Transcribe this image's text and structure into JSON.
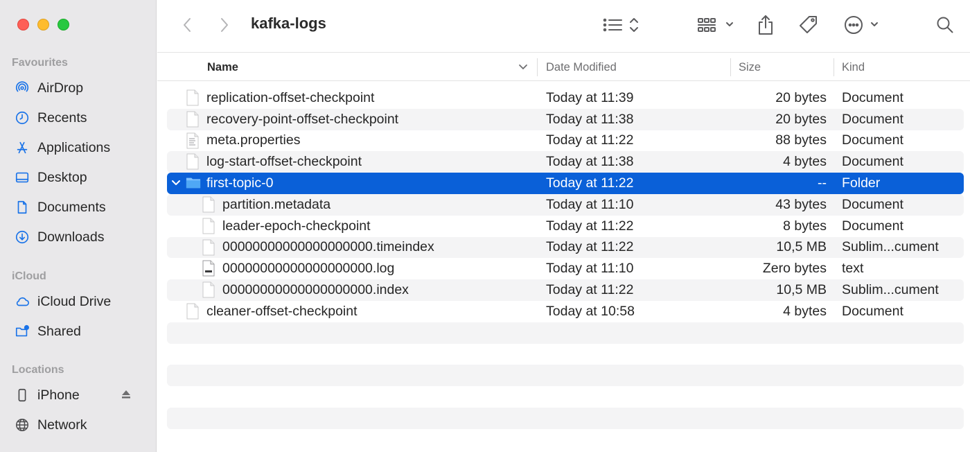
{
  "window": {
    "title": "kafka-logs"
  },
  "sidebar": {
    "sections": [
      {
        "title": "Favourites"
      },
      {
        "title": "iCloud"
      },
      {
        "title": "Locations"
      }
    ],
    "favourites": [
      {
        "label": "AirDrop",
        "icon": "airdrop-icon"
      },
      {
        "label": "Recents",
        "icon": "clock-icon"
      },
      {
        "label": "Applications",
        "icon": "applications-icon"
      },
      {
        "label": "Desktop",
        "icon": "desktop-icon"
      },
      {
        "label": "Documents",
        "icon": "document-icon"
      },
      {
        "label": "Downloads",
        "icon": "download-icon"
      }
    ],
    "icloud": [
      {
        "label": "iCloud Drive",
        "icon": "cloud-icon"
      },
      {
        "label": "Shared",
        "icon": "shared-folder-icon"
      }
    ],
    "locations": [
      {
        "label": "iPhone",
        "icon": "iphone-icon"
      },
      {
        "label": "Network",
        "icon": "globe-icon"
      }
    ]
  },
  "columns": {
    "name": "Name",
    "date": "Date Modified",
    "size": "Size",
    "kind": "Kind"
  },
  "files": [
    {
      "name": "replication-offset-checkpoint",
      "date": "Today at 11:39",
      "size": "20 bytes",
      "kind": "Document",
      "icon": "document-icon"
    },
    {
      "name": "recovery-point-offset-checkpoint",
      "date": "Today at 11:38",
      "size": "20 bytes",
      "kind": "Document",
      "icon": "document-icon"
    },
    {
      "name": "meta.properties",
      "date": "Today at 11:22",
      "size": "88 bytes",
      "kind": "Document",
      "icon": "text-document-icon"
    },
    {
      "name": "log-start-offset-checkpoint",
      "date": "Today at 11:38",
      "size": "4 bytes",
      "kind": "Document",
      "icon": "document-icon"
    },
    {
      "name": "first-topic-0",
      "date": "Today at 11:22",
      "size": "--",
      "kind": "Folder",
      "icon": "folder-icon",
      "selected": true,
      "expanded": true
    },
    {
      "name": "partition.metadata",
      "date": "Today at 11:10",
      "size": "43 bytes",
      "kind": "Document",
      "icon": "document-icon",
      "indent": true
    },
    {
      "name": "leader-epoch-checkpoint",
      "date": "Today at 11:22",
      "size": "8 bytes",
      "kind": "Document",
      "icon": "document-icon",
      "indent": true
    },
    {
      "name": "00000000000000000000.timeindex",
      "date": "Today at 11:22",
      "size": "10,5 MB",
      "kind": "Sublim...cument",
      "icon": "document-icon",
      "indent": true
    },
    {
      "name": "00000000000000000000.log",
      "date": "Today at 11:10",
      "size": "Zero bytes",
      "kind": "text",
      "icon": "log-file-icon",
      "indent": true
    },
    {
      "name": "00000000000000000000.index",
      "date": "Today at 11:22",
      "size": "10,5 MB",
      "kind": "Sublim...cument",
      "icon": "document-icon",
      "indent": true
    },
    {
      "name": "cleaner-offset-checkpoint",
      "date": "Today at 10:58",
      "size": "4 bytes",
      "kind": "Document",
      "icon": "document-icon"
    }
  ]
}
